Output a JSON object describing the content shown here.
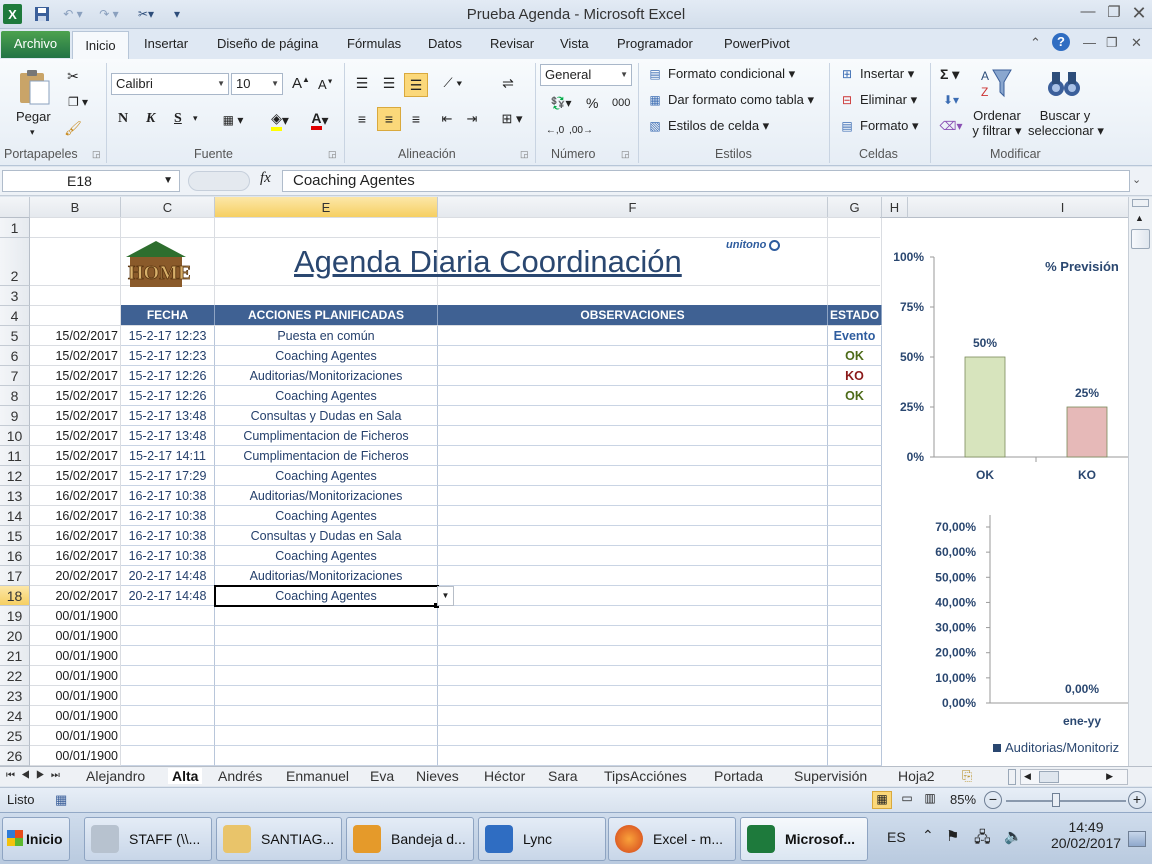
{
  "window": {
    "title": "Prueba Agenda  -  Microsoft Excel"
  },
  "ribbon": {
    "tabs": [
      "Archivo",
      "Inicio",
      "Insertar",
      "Diseño de página",
      "Fórmulas",
      "Datos",
      "Revisar",
      "Vista",
      "Programador",
      "PowerPivot"
    ],
    "clipboard": {
      "paste": "Pegar",
      "label": "Portapapeles"
    },
    "font": {
      "name": "Calibri",
      "size": "10",
      "label": "Fuente",
      "bold": "N",
      "italic": "K",
      "underline": "S"
    },
    "alignment": {
      "label": "Alineación"
    },
    "number": {
      "format": "General",
      "percent": "%",
      "thousands": "000",
      "label": "Número"
    },
    "styles": {
      "conditional": "Formato condicional",
      "table": "Dar formato como tabla",
      "cell": "Estilos de celda",
      "label": "Estilos"
    },
    "cells": {
      "insert": "Insertar",
      "delete": "Eliminar",
      "format": "Formato",
      "label": "Celdas"
    },
    "editing": {
      "sort1": "Ordenar",
      "sort2": "y filtrar",
      "find1": "Buscar y",
      "find2": "seleccionar",
      "label": "Modificar"
    }
  },
  "formula_bar": {
    "name_box": "E18",
    "fx": "fx",
    "content": "Coaching Agentes"
  },
  "columns": [
    "B",
    "C",
    "E",
    "F",
    "G",
    "H",
    "I"
  ],
  "rows": [
    "1",
    "2",
    "3",
    "4",
    "5",
    "6",
    "7",
    "8",
    "9",
    "10",
    "11",
    "12",
    "13",
    "14",
    "15",
    "16",
    "17",
    "18",
    "19",
    "20",
    "21",
    "22",
    "23",
    "24",
    "25",
    "26"
  ],
  "sheet": {
    "title": "Agenda Diaria Coordinación",
    "logo_text": "HOME",
    "brand": "unitono",
    "headers": {
      "fecha": "FECHA",
      "acciones": "ACCIONES PLANIFICADAS",
      "observaciones": "OBSERVACIONES",
      "estado": "ESTADO"
    },
    "records": [
      {
        "b": "15/02/2017",
        "c": "15-2-17 12:23",
        "e": "Puesta en común",
        "g": "Evento"
      },
      {
        "b": "15/02/2017",
        "c": "15-2-17 12:23",
        "e": "Coaching Agentes",
        "g": "OK"
      },
      {
        "b": "15/02/2017",
        "c": "15-2-17 12:26",
        "e": "Auditorias/Monitorizaciones",
        "g": "KO"
      },
      {
        "b": "15/02/2017",
        "c": "15-2-17 12:26",
        "e": "Coaching Agentes",
        "g": "OK"
      },
      {
        "b": "15/02/2017",
        "c": "15-2-17 13:48",
        "e": "Consultas y Dudas en Sala",
        "g": ""
      },
      {
        "b": "15/02/2017",
        "c": "15-2-17 13:48",
        "e": "Cumplimentacion de Ficheros",
        "g": ""
      },
      {
        "b": "15/02/2017",
        "c": "15-2-17 14:11",
        "e": "Cumplimentacion de Ficheros",
        "g": ""
      },
      {
        "b": "15/02/2017",
        "c": "15-2-17 17:29",
        "e": "Coaching Agentes",
        "g": ""
      },
      {
        "b": "16/02/2017",
        "c": "16-2-17 10:38",
        "e": "Auditorias/Monitorizaciones",
        "g": ""
      },
      {
        "b": "16/02/2017",
        "c": "16-2-17 10:38",
        "e": "Coaching Agentes",
        "g": ""
      },
      {
        "b": "16/02/2017",
        "c": "16-2-17 10:38",
        "e": "Consultas y Dudas en Sala",
        "g": ""
      },
      {
        "b": "16/02/2017",
        "c": "16-2-17 10:38",
        "e": "Coaching Agentes",
        "g": ""
      },
      {
        "b": "20/02/2017",
        "c": "20-2-17 14:48",
        "e": "Auditorias/Monitorizaciones",
        "g": ""
      },
      {
        "b": "20/02/2017",
        "c": "20-2-17 14:48",
        "e": "Coaching Agentes",
        "g": ""
      },
      {
        "b": "00/01/1900",
        "c": "",
        "e": "",
        "g": ""
      },
      {
        "b": "00/01/1900",
        "c": "",
        "e": "",
        "g": ""
      },
      {
        "b": "00/01/1900",
        "c": "",
        "e": "",
        "g": ""
      },
      {
        "b": "00/01/1900",
        "c": "",
        "e": "",
        "g": ""
      },
      {
        "b": "00/01/1900",
        "c": "",
        "e": "",
        "g": ""
      },
      {
        "b": "00/01/1900",
        "c": "",
        "e": "",
        "g": ""
      },
      {
        "b": "00/01/1900",
        "c": "",
        "e": "",
        "g": ""
      },
      {
        "b": "00/01/1900",
        "c": "",
        "e": "",
        "g": ""
      }
    ],
    "status_colors": {
      "Evento": "#2e5c9e",
      "OK": "#4d6b18",
      "KO": "#8b1a1a"
    }
  },
  "chart_data": [
    {
      "type": "bar",
      "title": "% Previsión",
      "categories": [
        "OK",
        "KO"
      ],
      "values": [
        0.5,
        0.25
      ],
      "data_labels": [
        "50%",
        "25%"
      ],
      "yticks": [
        "0%",
        "25%",
        "50%",
        "75%",
        "100%"
      ],
      "ylim": [
        0,
        1
      ],
      "colors": [
        "#d7e4bd",
        "#e6b9b8"
      ]
    },
    {
      "type": "bar",
      "categories": [
        "ene-yy"
      ],
      "values": [
        0
      ],
      "data_labels": [
        "0,00%"
      ],
      "yticks": [
        "0,00%",
        "10,00%",
        "20,00%",
        "30,00%",
        "40,00%",
        "50,00%",
        "60,00%",
        "70,00%"
      ],
      "ylim": [
        0,
        0.7
      ],
      "legend": "Auditorias/Monitoriz"
    }
  ],
  "sheet_tabs": [
    "Alejandro",
    "Alta",
    "Andrés",
    "Enmanuel",
    "Eva",
    "Nieves",
    "Héctor",
    "Sara",
    "TipsAcciónes",
    "Portada",
    "Supervisión",
    "Hoja2"
  ],
  "active_sheet": "Alta",
  "status_bar": {
    "ready": "Listo",
    "zoom": "85%"
  },
  "taskbar": {
    "start": "Inicio",
    "items": [
      "STAFF (\\\\...",
      "SANTIAG...",
      "Bandeja d...",
      "Lync",
      "Excel - m...",
      "Microsof..."
    ],
    "lang": "ES",
    "time": "14:49",
    "date": "20/02/2017"
  }
}
